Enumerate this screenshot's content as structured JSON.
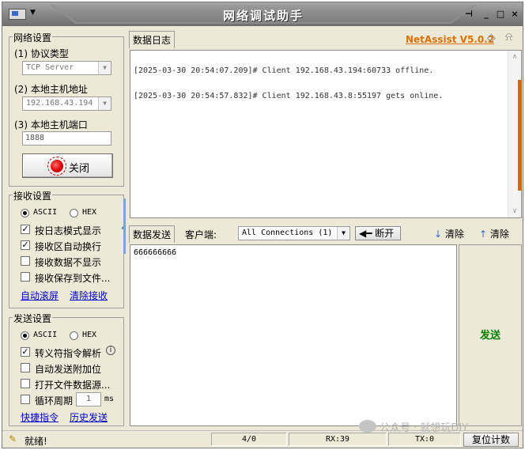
{
  "window": {
    "title": "网络调试助手"
  },
  "brand": {
    "name": "NetAssist V5.0.2"
  },
  "network": {
    "group_title": "网络设置",
    "protocol_label": "(1) 协议类型",
    "protocol_value": "TCP Server",
    "host_label": "(2) 本地主机地址",
    "host_value": "192.168.43.194",
    "port_label": "(3) 本地主机端口",
    "port_value": "1888",
    "close_button": "关闭",
    "lamp_color": "#e00000"
  },
  "receive": {
    "group_title": "接收设置",
    "ascii": "ASCII",
    "hex": "HEX",
    "options": [
      {
        "label": "按日志模式显示",
        "checked": true
      },
      {
        "label": "接收区自动换行",
        "checked": true
      },
      {
        "label": "接收数据不显示",
        "checked": false
      },
      {
        "label": "接收保存到文件...",
        "checked": false
      }
    ],
    "link_autoscroll": "自动滚屏",
    "link_clear": "清除接收"
  },
  "send": {
    "group_title": "发送设置",
    "ascii": "ASCII",
    "hex": "HEX",
    "options": [
      {
        "label": "转义符指令解析",
        "checked": true
      },
      {
        "label": "自动发送附加位",
        "checked": false
      },
      {
        "label": "打开文件数据源...",
        "checked": false
      },
      {
        "label": "循环周期",
        "checked": false
      }
    ],
    "period_value": "1",
    "period_unit": "ms",
    "link_shortcut": "快捷指令",
    "link_history": "历史发送"
  },
  "log": {
    "tab_label": "数据日志",
    "lines": [
      "[2025-03-30 20:54:07.209]# Client 192.168.43.194:60733 offline.",
      "[2025-03-30 20:54:57.832]# Client 192.168.43.8:55197 gets online."
    ]
  },
  "sendbar": {
    "tab_label": "数据发送",
    "client_label": "客户端:",
    "client_value": "All Connections (1)",
    "disconnect": "断开",
    "clear1": "清除",
    "clear2": "清除",
    "send_text": "666666666",
    "send_button": "发送"
  },
  "status": {
    "ready": "就绪!",
    "count": "4/0",
    "rx": "RX:39",
    "tx": "TX:0",
    "reset": "复位计数"
  },
  "watermark": "公众号 · 就想玩DIY"
}
